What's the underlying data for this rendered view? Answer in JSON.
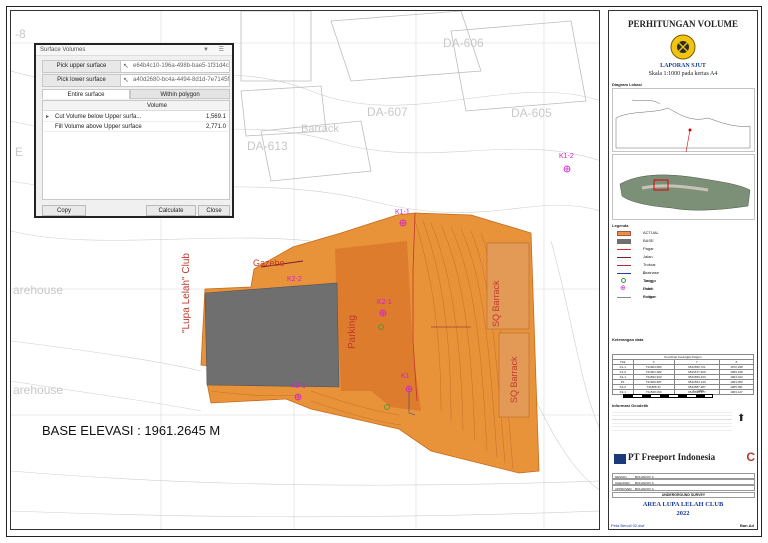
{
  "dialog": {
    "title": "Surface Volumes",
    "controls": "▼ ☰",
    "pick_upper_label": "Pick upper surface",
    "pick_upper_value": "e64b4c10-196a-498b-bae5-1f31d4c",
    "pick_lower_label": "Pick lower surface",
    "pick_lower_value": "a40d2680-bc4a-4494-8d1d-7e7145f",
    "tabs": [
      "Entire surface",
      "Within polygon"
    ],
    "column_header": "Volume",
    "rows": [
      {
        "label": "Cut Volume below Upper surfa...",
        "value": "1,569.1"
      },
      {
        "label": "Fill Volume above Upper surface",
        "value": "2,771.0"
      }
    ],
    "buttons": {
      "copy": "Copy",
      "calculate": "Calculate",
      "close": "Close"
    }
  },
  "map": {
    "base_elevation": "BASE ELEVASI : 1961.2645 M",
    "labels": {
      "da606": "DA-606",
      "da607": "DA-607",
      "da605": "DA-605",
      "da613": "DA-613",
      "barrack": "Barrack",
      "warehouse_top": "arehouse",
      "warehouse_bottom": "arehouse",
      "gazebo": "Gazebo",
      "club": "\"Lupa Lelah\" Club",
      "parking": "Parking",
      "sq_barrack_1": "SQ Barrack",
      "sq_barrack_2": "SQ Barrack",
      "edge_a": "-8",
      "edge_b": "E"
    },
    "points": {
      "k1_1": "K1-1",
      "k1_2": "K1-2",
      "k2_1": "K2-1",
      "k3_1": "K3-1",
      "k2_2": "K2-2",
      "k1": "K1"
    },
    "colors": {
      "actual": "#e8923a",
      "base": "#6f6f6f",
      "point": "#d21fd2"
    }
  },
  "title_block": {
    "heading": "PERHITUNGAN VOLUME",
    "report": "LAPORAN SJUT",
    "scale": "Skala 1:1000 pada kertas A4",
    "diagram_lokasi": "Diagram Lokasi",
    "legenda": "Legenda",
    "legend_items": [
      {
        "label": "ACTUAL",
        "color": "#e8923a",
        "kind": "fill"
      },
      {
        "label": "BASE",
        "color": "#6f6f6f",
        "kind": "fill"
      },
      {
        "label": "Pagar",
        "color": "#c0392b",
        "kind": "line"
      },
      {
        "label": "Jalan",
        "color": "#7a1f2b",
        "kind": "line"
      },
      {
        "label": "Trotoar & Tangga",
        "color": "#b03030",
        "kind": "line"
      },
      {
        "label": "Drainase",
        "color": "#1e3fa0",
        "kind": "line"
      },
      {
        "label": "Tiang Listrik",
        "color": "#2e9c2e",
        "kind": "circle"
      },
      {
        "label": "Point Poligon",
        "color": "#d21fd2",
        "kind": "cross"
      },
      {
        "label": "Kontur",
        "color": "#888888",
        "kind": "line"
      }
    ],
    "keterangan": "Keterangan data",
    "table_title": "Koordinat Kerangka Poligon",
    "table_headers": [
      "Titik",
      "X",
      "Y",
      "Z"
    ],
    "table_rows": [
      [
        "K1-1",
        "731903.683",
        "9541650.721",
        "1972.298"
      ],
      [
        "K1-2",
        "731901.282",
        "9541677.920",
        "1969.318"
      ],
      [
        "K2-1",
        "731833.933",
        "9541650.433",
        "1964.012"
      ],
      [
        "P1",
        "731909.687",
        "9541663.130",
        "1964.050"
      ],
      [
        "K2-2",
        "731808.31",
        "9541587.287",
        "1965.091"
      ],
      [
        "K3-1",
        "731838.090",
        "9541698.377",
        "1963.127"
      ]
    ],
    "scale_bar": "1 : 1000",
    "informasi": "Informasi Geodetik",
    "company": "PT Freeport Indonesia",
    "info_rows": [
      {
        "k": "DESIGN",
        "v": "BOLVAROV A"
      },
      {
        "k": "CHECKED",
        "v": "BOLVAROV A"
      },
      {
        "k": "APPROVED",
        "v": "BOLVAROV A"
      }
    ],
    "dept": "UNDERGROUND SURVEY",
    "area": "AREA LUPA LELAH CLUB",
    "year": "2022",
    "file": "Peta Benoli 02.dwf",
    "sheet": "Ban.Ad"
  }
}
